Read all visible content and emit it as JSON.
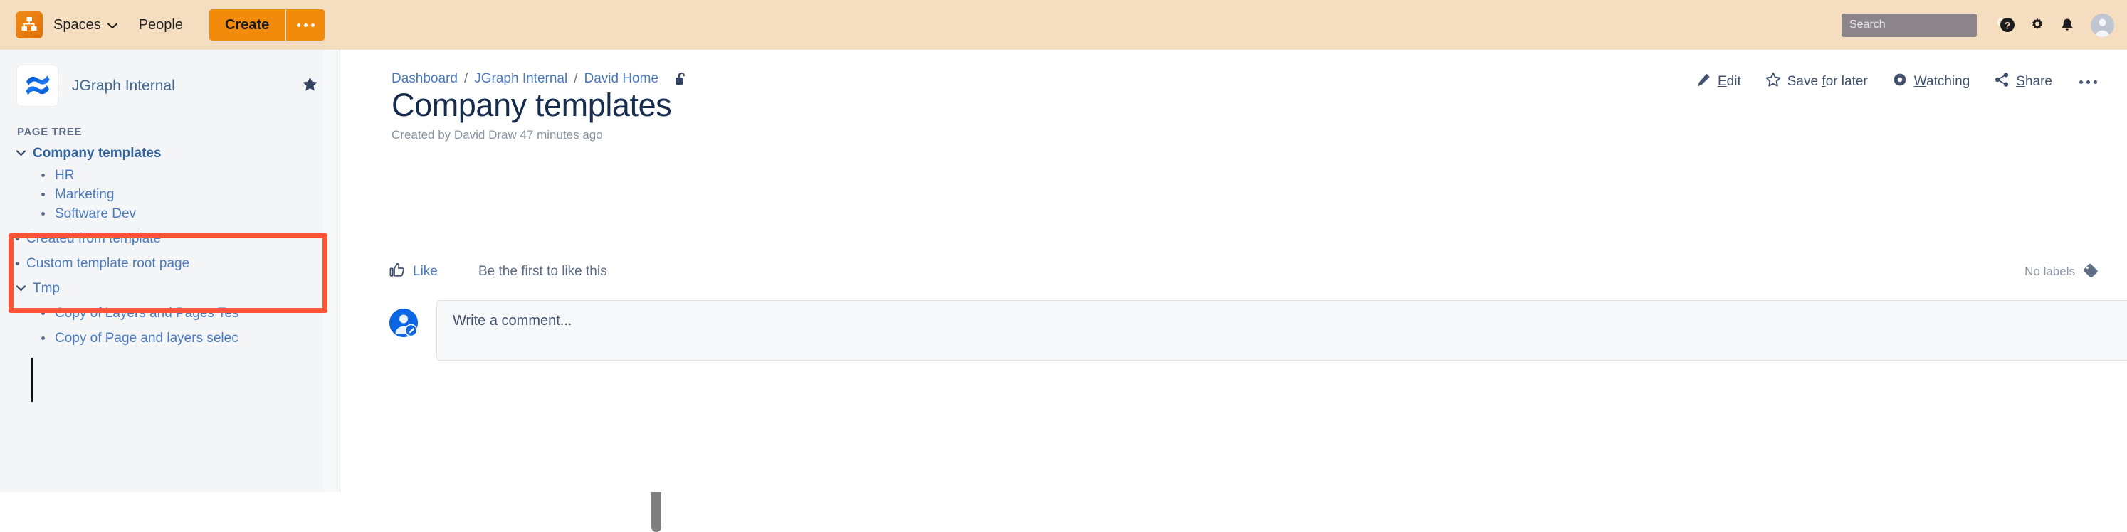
{
  "topnav": {
    "logo_icon": "drawio-logo-icon",
    "spaces_label": "Spaces",
    "people_label": "People",
    "create_label": "Create",
    "more_icon": "ellipsis-icon",
    "search": {
      "value": "",
      "placeholder": "Search",
      "icon": "search-icon"
    },
    "help_icon": "help-icon",
    "settings_icon": "gear-icon",
    "notifications_icon": "bell-icon",
    "profile_icon": "avatar-icon",
    "colors": {
      "bar_background": "#f5ddc0",
      "button": "#f28b0c",
      "search_field": "#8b8589"
    }
  },
  "sidebar": {
    "space_name": "JGraph Internal",
    "space_icon": "confluence-space-logo-icon",
    "star_icon": "star-filled-icon",
    "tree_heading": "PAGE TREE",
    "tree": [
      {
        "label": "Company templates",
        "level": 0,
        "twisty": "chevron-down-icon",
        "current": true
      },
      {
        "label": "HR",
        "level": 1,
        "twisty": "bullet",
        "current": false
      },
      {
        "label": "Marketing",
        "level": 1,
        "twisty": "bullet",
        "current": false
      },
      {
        "label": "Software Dev",
        "level": 1,
        "twisty": "bullet",
        "current": false
      },
      {
        "label": "Created from template",
        "level": 0,
        "twisty": "bullet",
        "current": false
      },
      {
        "label": "Custom template root page",
        "level": 0,
        "twisty": "bullet",
        "current": false
      },
      {
        "label": "Tmp",
        "level": 0,
        "twisty": "chevron-down-icon",
        "current": false
      },
      {
        "label": "Copy of Layers and Pages Tes",
        "level": 1,
        "twisty": "bullet",
        "current": false
      },
      {
        "label": "Copy of Page and layers selec",
        "level": 1,
        "twisty": "bullet",
        "current": false
      }
    ],
    "annotation": {
      "color": "#fb5338",
      "shape": "rectangle"
    },
    "scrollbar": {
      "icon": "vertical-scrollbar"
    }
  },
  "main": {
    "breadcrumb": [
      "Dashboard",
      "JGraph Internal",
      "David Home"
    ],
    "breadcrumb_separator": "/",
    "restrictions_icon": "unlocked-padlock-icon",
    "page_title": "Company templates",
    "byline": "Created by David Draw 47 minutes ago",
    "actions": [
      {
        "icon": "pencil-icon",
        "pre": "",
        "key": "E",
        "post": "dit"
      },
      {
        "icon": "star-icon",
        "pre": "Save ",
        "key": "f",
        "post": "or later"
      },
      {
        "icon": "eye-icon",
        "pre": "",
        "key": "W",
        "post": "atching"
      },
      {
        "icon": "share-icon",
        "pre": "",
        "key": "S",
        "post": "hare"
      }
    ],
    "actions_more_icon": "ellipsis-icon",
    "like": {
      "icon": "thumbs-up-icon",
      "label": "Like",
      "status": "Be the first to like this"
    },
    "labels": {
      "text": "No labels",
      "icon": "label-tag-icon"
    },
    "comment": {
      "avatar_icon": "user-edit-avatar-icon",
      "value": "",
      "placeholder": "Write a comment..."
    }
  }
}
